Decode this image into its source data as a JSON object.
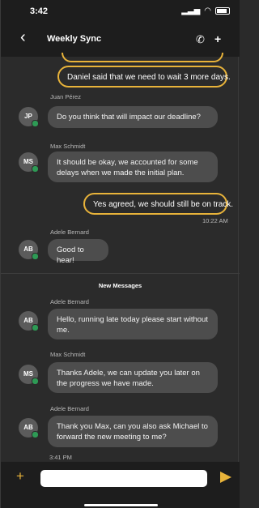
{
  "status": {
    "time": "3:42",
    "signal_icon": "signal-icon",
    "wifi_icon": "wifi-icon",
    "battery_icon": "battery-icon"
  },
  "header": {
    "title": "Weekly Sync",
    "back_icon": "chevron-left-icon",
    "call_icon": "phone-icon",
    "add_icon": "add-user-icon"
  },
  "messages": [
    {
      "from": "self",
      "text": "Daniel said that we need to wait 3 more days."
    },
    {
      "from": "Juan Pérez",
      "initials": "JP",
      "text": "Do you think that will impact our deadline?"
    },
    {
      "from": "Max Schmidt",
      "initials": "MS",
      "text": "It should be okay, we accounted for some delays when we made the initial plan."
    },
    {
      "from": "self",
      "text": "Yes agreed, we should still be on track."
    },
    {
      "timestamp": "10:22 AM"
    },
    {
      "from": "Adele Bernard",
      "initials": "AB",
      "text": "Good to hear!"
    }
  ],
  "new_messages_label": "New Messages",
  "new_messages": [
    {
      "from": "Adele Bernard",
      "initials": "AB",
      "text": "Hello, running late today please start without me."
    },
    {
      "from": "Max Schmidt",
      "initials": "MS",
      "text": "Thanks Adele, we can update you later on the progress we have made."
    },
    {
      "from": "Adele Bernard",
      "initials": "AB",
      "text": "Thank you Max, can you also ask Michael to forward the new meeting to me?"
    },
    {
      "timestamp": "3:41 PM"
    }
  ],
  "composer": {
    "placeholder": "",
    "add_icon": "plus-icon",
    "send_icon": "send-icon"
  },
  "colors": {
    "accent": "#e8b33a",
    "online": "#2e9a55",
    "bubble": "#4d4d4d",
    "background": "#2b2b2b"
  }
}
